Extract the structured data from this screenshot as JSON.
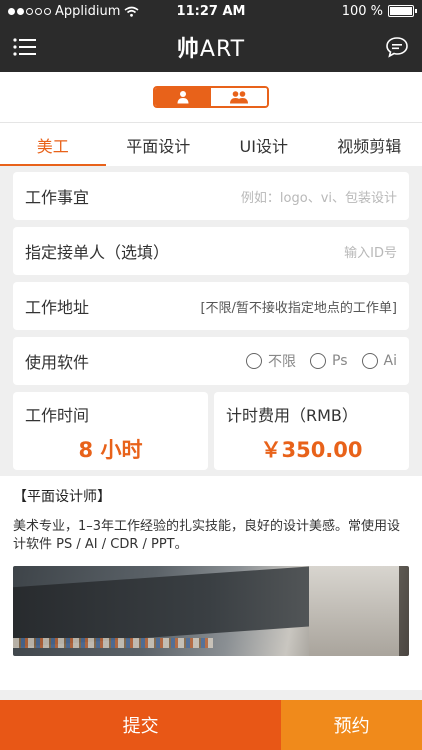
{
  "status_bar": {
    "carrier": "Applidium",
    "time": "11:27 AM",
    "battery": "100 %"
  },
  "nav": {
    "logo_main": "帅",
    "logo_art": "ART",
    "menu_icon": "menu-icon",
    "chat_icon": "chat-icon"
  },
  "toggle": {
    "single_icon": "person-icon",
    "group_icon": "group-icon",
    "accent": "#e8621a"
  },
  "tabs": [
    {
      "label": "美工",
      "active": true
    },
    {
      "label": "平面设计",
      "active": false
    },
    {
      "label": "UI设计",
      "active": false
    },
    {
      "label": "视频剪辑",
      "active": false
    }
  ],
  "form": {
    "work_item": {
      "label": "工作事宜",
      "placeholder": "例如：logo、vi、包装设计"
    },
    "assignee": {
      "label": "指定接单人（选填）",
      "placeholder": "输入ID号"
    },
    "address": {
      "label": "工作地址",
      "note": "[不限/暂不接收指定地点的工作单]"
    },
    "software": {
      "label": "使用软件",
      "options": [
        "不限",
        "Ps",
        "Ai"
      ]
    },
    "work_time": {
      "label": "工作时间",
      "value": "8 小时"
    },
    "hourly_fee": {
      "label": "计时费用（RMB）",
      "value": "￥350.00"
    }
  },
  "description": {
    "title": "【平面设计师】",
    "body": "美术专业，1–3年工作经验的扎实技能，良好的设计美感。常使用设计软件 PS / AI / CDR / PPT。"
  },
  "actions": {
    "submit": "提交",
    "reserve": "预约"
  },
  "colors": {
    "accent": "#e8621a",
    "submit_bg": "#e85716",
    "reserve_bg": "#f08a1b",
    "header_bg": "#2b2b2b"
  }
}
